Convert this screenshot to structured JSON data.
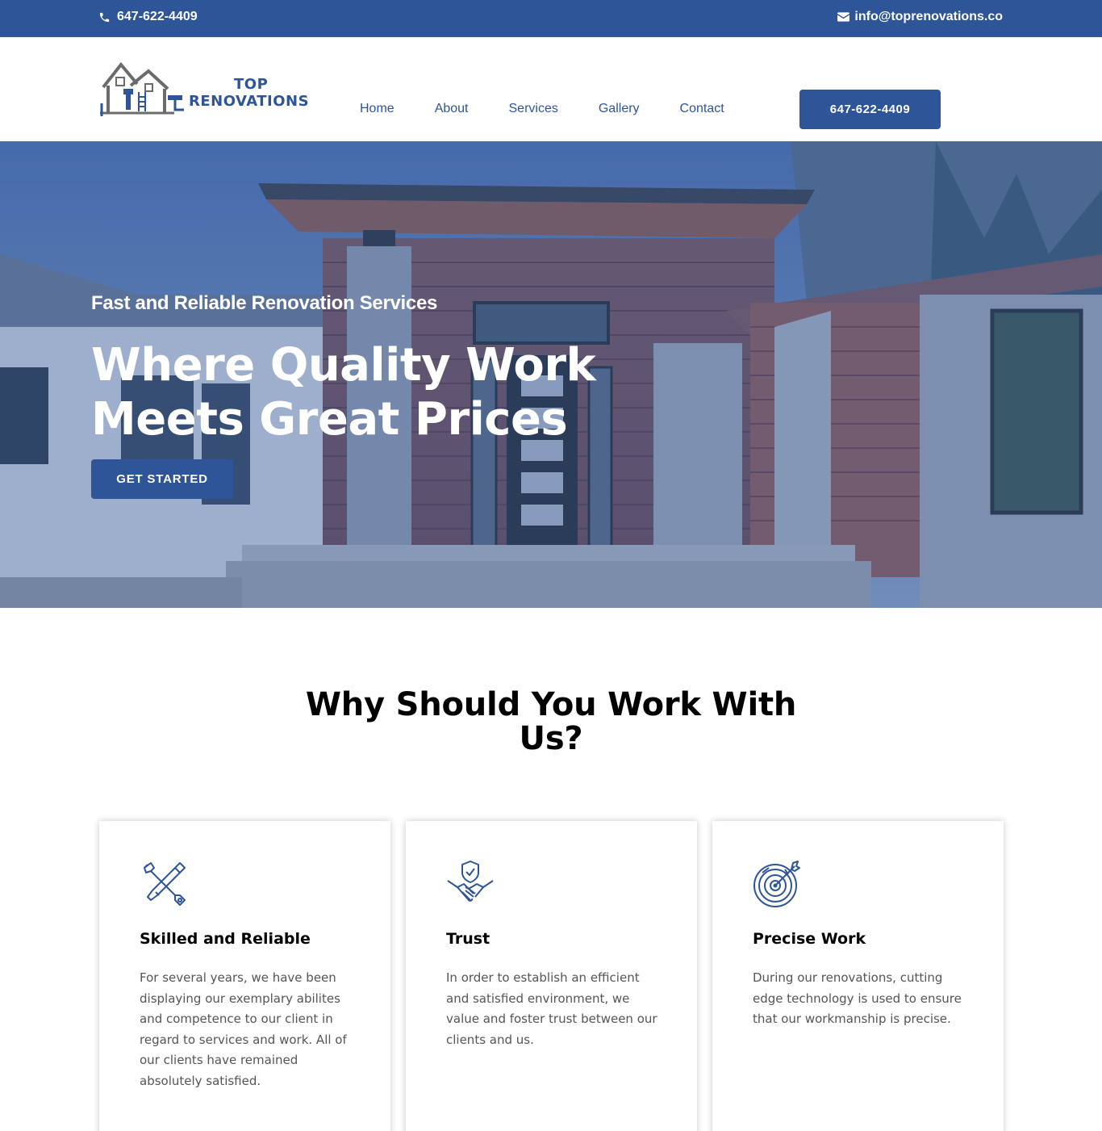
{
  "topbar": {
    "phone": "647-622-4409",
    "email": "info@toprenovations.co"
  },
  "logo": {
    "line1": "TOP",
    "line2": "RENOVATIONS"
  },
  "nav": {
    "items": [
      "Home",
      "About",
      "Services",
      "Gallery",
      "Contact"
    ]
  },
  "header_cta": "647-622-4409",
  "hero": {
    "kicker": "Fast and Reliable Renovation Services",
    "title_line1": "Where Quality Work",
    "title_line2": "Meets Great Prices",
    "button": "GET STARTED"
  },
  "why": {
    "title": "Why Should You Work With Us?",
    "cards": [
      {
        "icon": "tools-icon",
        "title": "Skilled and Reliable",
        "text": "For several years, we have been displaying our exemplary abilites and competence to our client in regard to services and work. All of our clients have remained absolutely satisfied."
      },
      {
        "icon": "handshake-shield-icon",
        "title": "Trust",
        "text": "In order to establish an efficient and satisfied environment, we value and foster trust between our clients and us."
      },
      {
        "icon": "target-icon",
        "title": "Precise Work",
        "text": "During our renovations, cutting edge technology is used to ensure that our workmanship is precise."
      }
    ]
  },
  "colors": {
    "brand": "#2e5597",
    "text": "#000000",
    "body_text": "#555555"
  }
}
